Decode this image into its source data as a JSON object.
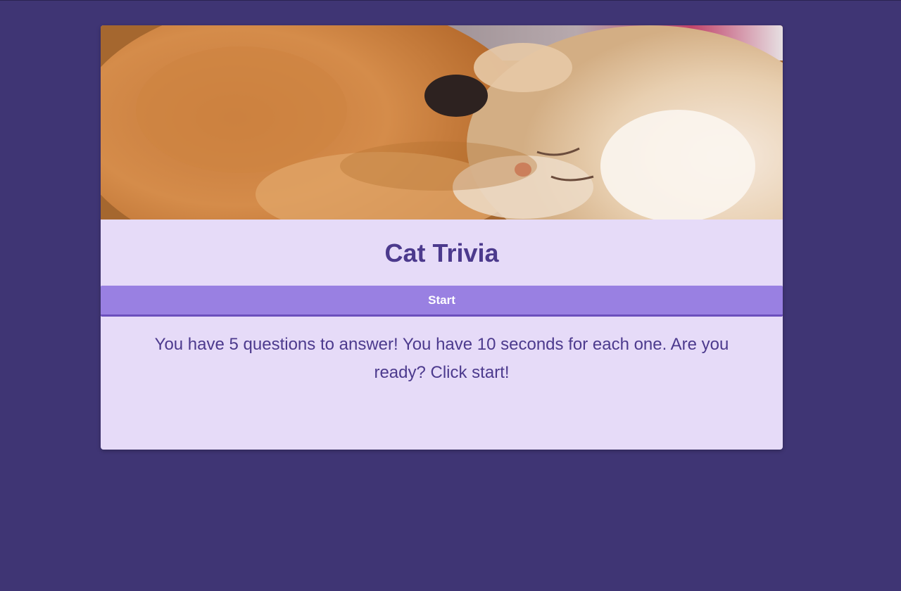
{
  "page": {
    "background_color": "#3f3574"
  },
  "card": {
    "hero_image": {
      "subject": "two cats sleeping",
      "icon": "cat-photo"
    },
    "title": "Cat Trivia",
    "start_button_label": "Start",
    "intro_text": "You have 5 questions to answer! You have 10 seconds for each one. Are you ready? Click start!"
  },
  "colors": {
    "card_background": "#e6dbf8",
    "title_text": "#4c3a8d",
    "button_background": "#9980e2",
    "button_border": "#6b4fbd",
    "button_text": "#ffffff"
  }
}
